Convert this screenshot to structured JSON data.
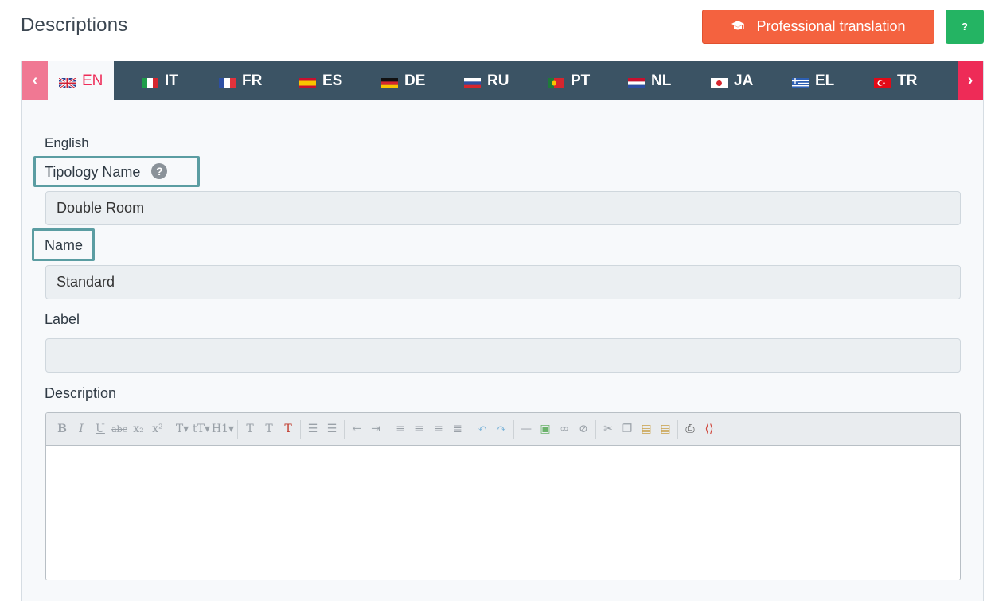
{
  "header": {
    "title": "Descriptions",
    "pro_translation_label": "Professional translation",
    "help_label": "?"
  },
  "tabs": [
    {
      "code": "EN",
      "flag": "uk-flag-icon",
      "active": true
    },
    {
      "code": "IT",
      "flag": "italy-flag-icon"
    },
    {
      "code": "FR",
      "flag": "france-flag-icon"
    },
    {
      "code": "ES",
      "flag": "spain-flag-icon"
    },
    {
      "code": "DE",
      "flag": "germany-flag-icon"
    },
    {
      "code": "RU",
      "flag": "russia-flag-icon"
    },
    {
      "code": "PT",
      "flag": "portugal-flag-icon"
    },
    {
      "code": "NL",
      "flag": "netherlands-flag-icon"
    },
    {
      "code": "JA",
      "flag": "japan-flag-icon"
    },
    {
      "code": "EL",
      "flag": "greece-flag-icon"
    },
    {
      "code": "TR",
      "flag": "turkey-flag-icon"
    }
  ],
  "tab_nav": {
    "prev": "‹",
    "next": "›"
  },
  "form": {
    "language_heading": "English",
    "tipology_label": "Tipology Name",
    "tipology_value": "Double Room",
    "name_label": "Name",
    "name_value": "Standard",
    "label_label": "Label",
    "label_value": "",
    "description_label": "Description"
  },
  "colors": {
    "accent_red": "#ee2b57",
    "pro_button": "#f4623f",
    "help_button": "#24b463",
    "tabbar": "#3b5364",
    "highlight_box": "#5b9da2"
  }
}
